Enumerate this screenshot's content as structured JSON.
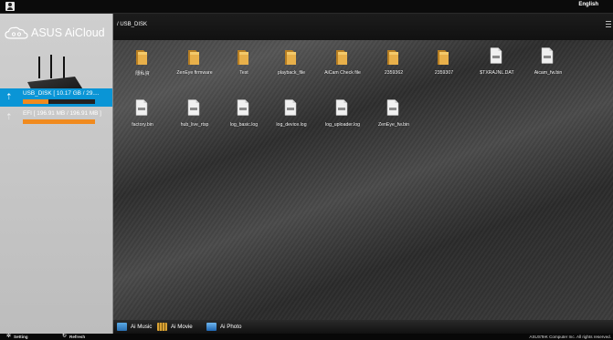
{
  "header": {
    "language": "English",
    "user_icon": "user-icon"
  },
  "brand": {
    "name": "ASUS AiCloud"
  },
  "devices": [
    {
      "label": "USB_DISK [ 10.17 GB / 29....",
      "usage_percent": 35,
      "active": true
    },
    {
      "label": "EFI [ 196.91 MB / 196.91 MB ]",
      "usage_percent": 100,
      "active": false
    }
  ],
  "main": {
    "path": "/ USB_DISK",
    "items": [
      {
        "name": "隱私資",
        "type": "folder"
      },
      {
        "name": "ZenEye firmware",
        "type": "folder"
      },
      {
        "name": "Test",
        "type": "folder"
      },
      {
        "name": "playback_file",
        "type": "folder"
      },
      {
        "name": "AiCam Check file",
        "type": "folder"
      },
      {
        "name": "2359362",
        "type": "folder"
      },
      {
        "name": "2359307",
        "type": "folder"
      },
      {
        "name": "$TXRAJNL.DAT",
        "type": "file"
      },
      {
        "name": "Aicam_fw.bin",
        "type": "file"
      },
      {
        "name": "factory.bin",
        "type": "file"
      },
      {
        "name": "hub_live_rtsp",
        "type": "file"
      },
      {
        "name": "log_basic.log",
        "type": "file"
      },
      {
        "name": "log_device.log",
        "type": "file"
      },
      {
        "name": "log_uploader.log",
        "type": "file"
      },
      {
        "name": "ZenEye_fw.bin",
        "type": "file"
      }
    ]
  },
  "media": [
    {
      "label": "Ai Music",
      "icon": "music-icon",
      "color": "#3a8fd1"
    },
    {
      "label": "Ai Movie",
      "icon": "movie-icon",
      "color": "#d9a235"
    },
    {
      "label": "Ai Photo",
      "icon": "photo-icon",
      "color": "#2f84d4"
    }
  ],
  "footer": {
    "setting": "Setting",
    "refresh": "Refresh",
    "copyright": "ASUSTeK Computer Inc. All rights reserved."
  },
  "colors": {
    "accent": "#0a95d6",
    "usage_bar": "#f08a1e",
    "folder": "#e8b04a"
  }
}
